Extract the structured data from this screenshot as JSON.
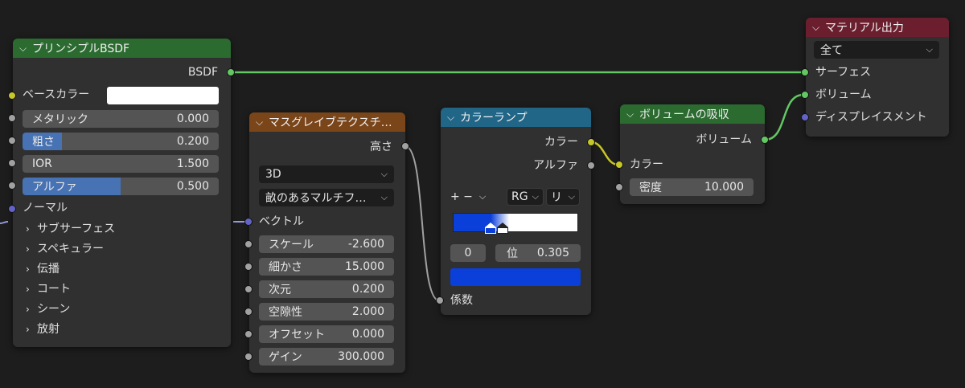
{
  "nodes": {
    "principled": {
      "title": "プリンシプルBSDF",
      "output_label": "BSDF",
      "base_color_label": "ベースカラー",
      "base_color_value": "#ffffff",
      "inputs": [
        {
          "label": "メタリック",
          "value": "0.000",
          "fill": 0.0
        },
        {
          "label": "粗さ",
          "value": "0.200",
          "fill": 0.2
        },
        {
          "label": "IOR",
          "value": "1.500",
          "fill": 0.0
        },
        {
          "label": "アルファ",
          "value": "0.500",
          "fill": 0.5
        }
      ],
      "normal_label": "ノーマル",
      "panels": [
        "サブサーフェス",
        "スペキュラー",
        "伝播",
        "コート",
        "シーン",
        "放射"
      ]
    },
    "musgrave": {
      "title": "マスグレイブテクスチ…",
      "output_label": "高さ",
      "dimension": "3D",
      "type": "畝のあるマルチフ…",
      "vector_label": "ベクトル",
      "inputs": [
        {
          "label": "スケール",
          "value": "-2.600"
        },
        {
          "label": "細かさ",
          "value": "15.000"
        },
        {
          "label": "次元",
          "value": "0.200"
        },
        {
          "label": "空隙性",
          "value": "2.000"
        },
        {
          "label": "オフセット",
          "value": "0.000"
        },
        {
          "label": "ゲイン",
          "value": "300.000"
        }
      ]
    },
    "color_ramp": {
      "title": "カラーランプ",
      "output_color_label": "カラー",
      "output_alpha_label": "アルファ",
      "add_remove": "+ −",
      "color_mode": "RG",
      "interpolation": "リ",
      "stop_index": "0",
      "pos_label": "位",
      "pos_value": "0.305",
      "stop_color": "#0a3fd9",
      "input_label": "係数"
    },
    "volume_absorption": {
      "title": "ボリュームの吸収",
      "output_label": "ボリューム",
      "color_label": "カラー",
      "density_label": "密度",
      "density_value": "10.000"
    },
    "material_output": {
      "title": "マテリアル出力",
      "target": "全て",
      "inputs": [
        "サーフェス",
        "ボリューム",
        "ディスプレイスメント"
      ]
    }
  },
  "colors": {
    "socket_shader": "#63c763",
    "socket_color": "#c7c729",
    "socket_float": "#a1a1a1",
    "socket_vector": "#6363c7",
    "field_fill": "#4772b3"
  }
}
